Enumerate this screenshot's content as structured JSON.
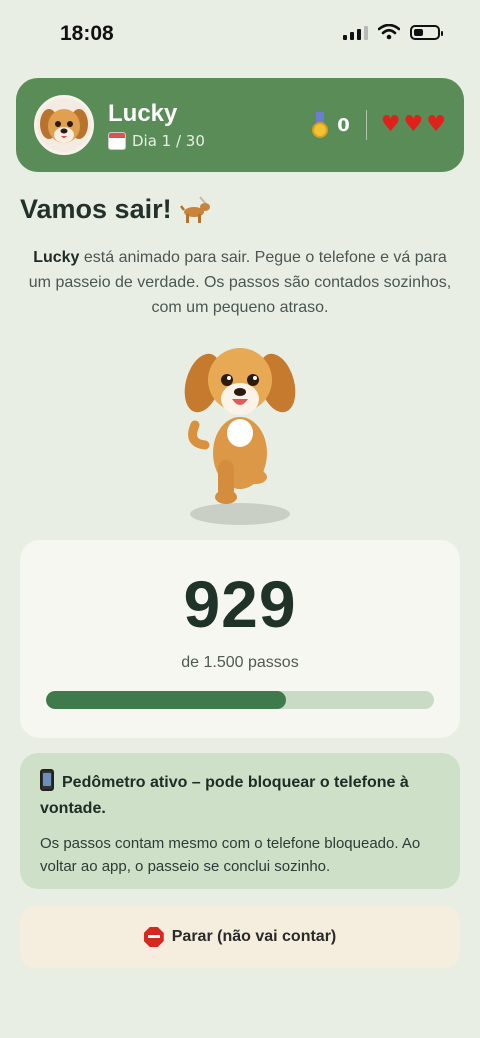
{
  "status_bar": {
    "time": "18:08"
  },
  "header": {
    "pet_name": "Lucky",
    "day_label": "Dia 1 / 30",
    "medals": "0",
    "hearts": 3
  },
  "page": {
    "title": "Vamos sair!",
    "description_name": "Lucky",
    "description_rest": " está animado para sair. Pegue o telefone e vá para um passeio de verdade. Os passos são contados sozinhos, com um pequeno atraso."
  },
  "steps": {
    "count": "929",
    "goal_label": "de 1.500 passos",
    "progress_fraction": 0.619
  },
  "info": {
    "title": "Pedômetro ativo – pode bloquear o telefone à vontade.",
    "body": "Os passos contam mesmo com o telefone bloqueado. Ao voltar ao app, o passeio se conclui sozinho."
  },
  "stop_button": {
    "label": "Parar (não vai contar)"
  },
  "icons": [
    "calendar-icon",
    "medal-icon",
    "heart-icon",
    "guide-dog-icon",
    "phone-icon",
    "stop-icon"
  ],
  "colors": {
    "header_bg": "#5a8c57",
    "progress_fill": "#3f7a4c",
    "progress_track": "#c9dbc4",
    "heart": "#e0201a"
  }
}
